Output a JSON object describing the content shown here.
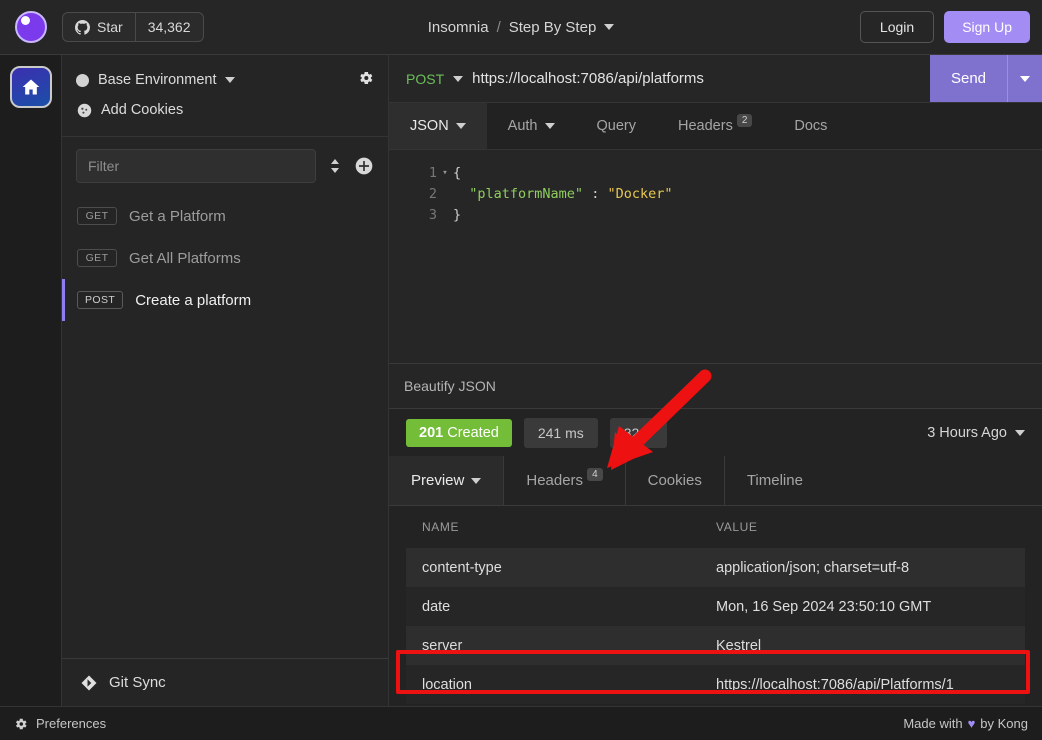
{
  "topbar": {
    "logo_icon": "insomnia-logo-icon",
    "github_icon": "github-icon",
    "star_label": "Star",
    "star_count": "34,362",
    "breadcrumb_app": "Insomnia",
    "breadcrumb_sep": "/",
    "breadcrumb_workspace": "Step By Step",
    "login_label": "Login",
    "signup_label": "Sign Up"
  },
  "rail": {
    "home_icon": "home-icon"
  },
  "sidebar": {
    "environment_label": "Base Environment",
    "settings_icon": "gear-icon",
    "cookies_icon": "cookie-icon",
    "cookies_label": "Add Cookies",
    "filter_placeholder": "Filter",
    "sort_icon": "sort-icon",
    "add_icon": "plus-circle-icon",
    "requests": [
      {
        "method": "GET",
        "name": "Get a Platform",
        "active": false
      },
      {
        "method": "GET",
        "name": "Get All Platforms",
        "active": false
      },
      {
        "method": "POST",
        "name": "Create a platform",
        "active": true
      }
    ],
    "gitsync_icon": "git-sync-icon",
    "gitsync_label": "Git Sync"
  },
  "request": {
    "method": "POST",
    "url": "https://localhost:7086/api/platforms",
    "send_label": "Send",
    "tabs": [
      {
        "label": "JSON",
        "active": true,
        "has_caret": true,
        "badge": ""
      },
      {
        "label": "Auth",
        "active": false,
        "has_caret": true,
        "badge": ""
      },
      {
        "label": "Query",
        "active": false,
        "has_caret": false,
        "badge": ""
      },
      {
        "label": "Headers",
        "active": false,
        "has_caret": false,
        "badge": "2"
      },
      {
        "label": "Docs",
        "active": false,
        "has_caret": false,
        "badge": ""
      }
    ],
    "body_lines": [
      {
        "num": "1",
        "fold": true,
        "segments": [
          {
            "text": "{",
            "type": "punc"
          }
        ]
      },
      {
        "num": "2",
        "fold": false,
        "segments": [
          {
            "text": "  ",
            "type": "punc"
          },
          {
            "text": "\"platformName\"",
            "type": "key"
          },
          {
            "text": " : ",
            "type": "punc"
          },
          {
            "text": "\"Docker\"",
            "type": "val"
          }
        ]
      },
      {
        "num": "3",
        "fold": false,
        "segments": [
          {
            "text": "}",
            "type": "punc"
          }
        ]
      }
    ],
    "beautify_label": "Beautify JSON"
  },
  "response": {
    "status_code": "201",
    "status_text": "Created",
    "time": "241 ms",
    "size": "32 B",
    "age": "3 Hours Ago",
    "tabs": [
      {
        "label": "Preview",
        "active": true,
        "has_caret": true,
        "badge": ""
      },
      {
        "label": "Headers",
        "active": false,
        "has_caret": false,
        "badge": "4"
      },
      {
        "label": "Cookies",
        "active": false,
        "has_caret": false,
        "badge": ""
      },
      {
        "label": "Timeline",
        "active": false,
        "has_caret": false,
        "badge": ""
      }
    ],
    "headers_columns": [
      "NAME",
      "VALUE"
    ],
    "headers": [
      {
        "name": "content-type",
        "value": "application/json; charset=utf-8"
      },
      {
        "name": "date",
        "value": "Mon, 16 Sep 2024 23:50:10 GMT"
      },
      {
        "name": "server",
        "value": "Kestrel"
      },
      {
        "name": "location",
        "value": "https://localhost:7086/api/Platforms/1"
      }
    ]
  },
  "statusbar": {
    "preferences_icon": "gear-icon",
    "preferences_label": "Preferences",
    "made_prefix": "Made with",
    "heart_icon": "heart-icon",
    "made_suffix": "by Kong"
  },
  "annotations": {
    "highlight_color": "#ee1111",
    "arrow_target": "Headers",
    "rect_target": "location"
  }
}
